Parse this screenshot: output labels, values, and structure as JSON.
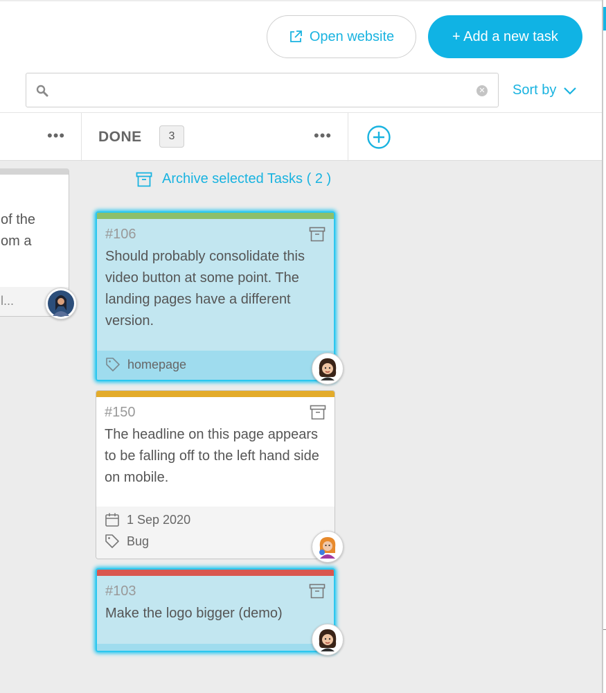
{
  "header": {
    "open_website_label": "Open website",
    "add_task_label": "+ Add a new task",
    "sort_by_label": "Sort by"
  },
  "search": {
    "value": "",
    "placeholder": ""
  },
  "columns": {
    "done": {
      "title": "DONE",
      "count": "3",
      "archive_link": "Archive selected Tasks ( 2 )"
    }
  },
  "partial_card": {
    "lines": [
      "of the",
      "om a"
    ],
    "footer_text": "l..."
  },
  "cards": [
    {
      "id": "#106",
      "text": "Should probably consolidate this video button at some point. The landing pages have a different version.",
      "tag": "homepage",
      "stripe_color": "#8dbf6a",
      "selected": true
    },
    {
      "id": "#150",
      "text": "The headline on this page appears to be falling off to the left hand side on mobile.",
      "due_date": "1 Sep 2020",
      "tag": "Bug",
      "stripe_color": "#e3ab2a",
      "selected": false
    },
    {
      "id": "#103",
      "text": "Make the logo bigger (demo)",
      "stripe_color": "#d9574f",
      "selected": true
    }
  ],
  "colors": {
    "accent": "#10b3e4",
    "selected_card": "#c2e6f0",
    "selected_border": "#2cc7ef"
  }
}
